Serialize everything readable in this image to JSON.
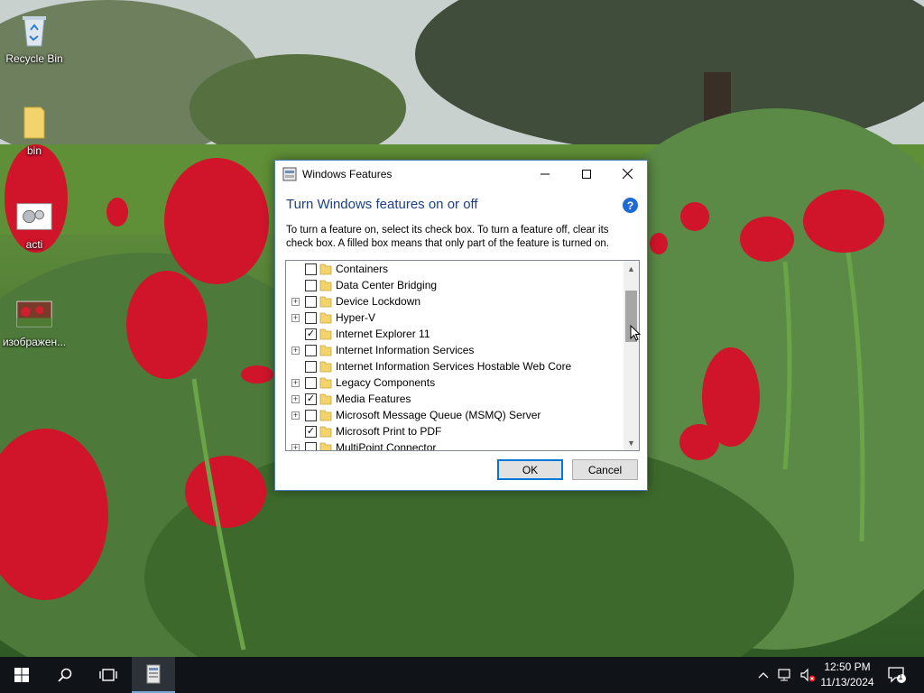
{
  "desktop": {
    "icons": [
      {
        "label": "Recycle Bin",
        "icon": "recycle-bin-icon"
      },
      {
        "label": "bin",
        "icon": "folder-icon"
      },
      {
        "label": "acti",
        "icon": "gears-icon"
      },
      {
        "label": "изображен...",
        "icon": "image-file-icon"
      }
    ]
  },
  "dialog": {
    "title": "Windows Features",
    "heading": "Turn Windows features on or off",
    "help": "?",
    "description": "To turn a feature on, select its check box. To turn a feature off, clear its check box. A filled box means that only part of the feature is turned on.",
    "features": [
      {
        "label": "Containers",
        "checked": false,
        "expandable": false
      },
      {
        "label": "Data Center Bridging",
        "checked": false,
        "expandable": false
      },
      {
        "label": "Device Lockdown",
        "checked": false,
        "expandable": true
      },
      {
        "label": "Hyper-V",
        "checked": false,
        "expandable": true
      },
      {
        "label": "Internet Explorer 11",
        "checked": true,
        "expandable": false
      },
      {
        "label": "Internet Information Services",
        "checked": false,
        "expandable": true
      },
      {
        "label": "Internet Information Services Hostable Web Core",
        "checked": false,
        "expandable": false
      },
      {
        "label": "Legacy Components",
        "checked": false,
        "expandable": true
      },
      {
        "label": "Media Features",
        "checked": true,
        "expandable": true
      },
      {
        "label": "Microsoft Message Queue (MSMQ) Server",
        "checked": false,
        "expandable": true
      },
      {
        "label": "Microsoft Print to PDF",
        "checked": true,
        "expandable": false
      },
      {
        "label": "MultiPoint Connector",
        "checked": false,
        "expandable": true
      }
    ],
    "ok_label": "OK",
    "cancel_label": "Cancel"
  },
  "taskbar": {
    "time": "12:50 PM",
    "date": "11/13/2024",
    "notification_count": "1"
  },
  "colors": {
    "accent": "#0078d7",
    "heading": "#1a3f8c",
    "taskbar": "#101418"
  }
}
